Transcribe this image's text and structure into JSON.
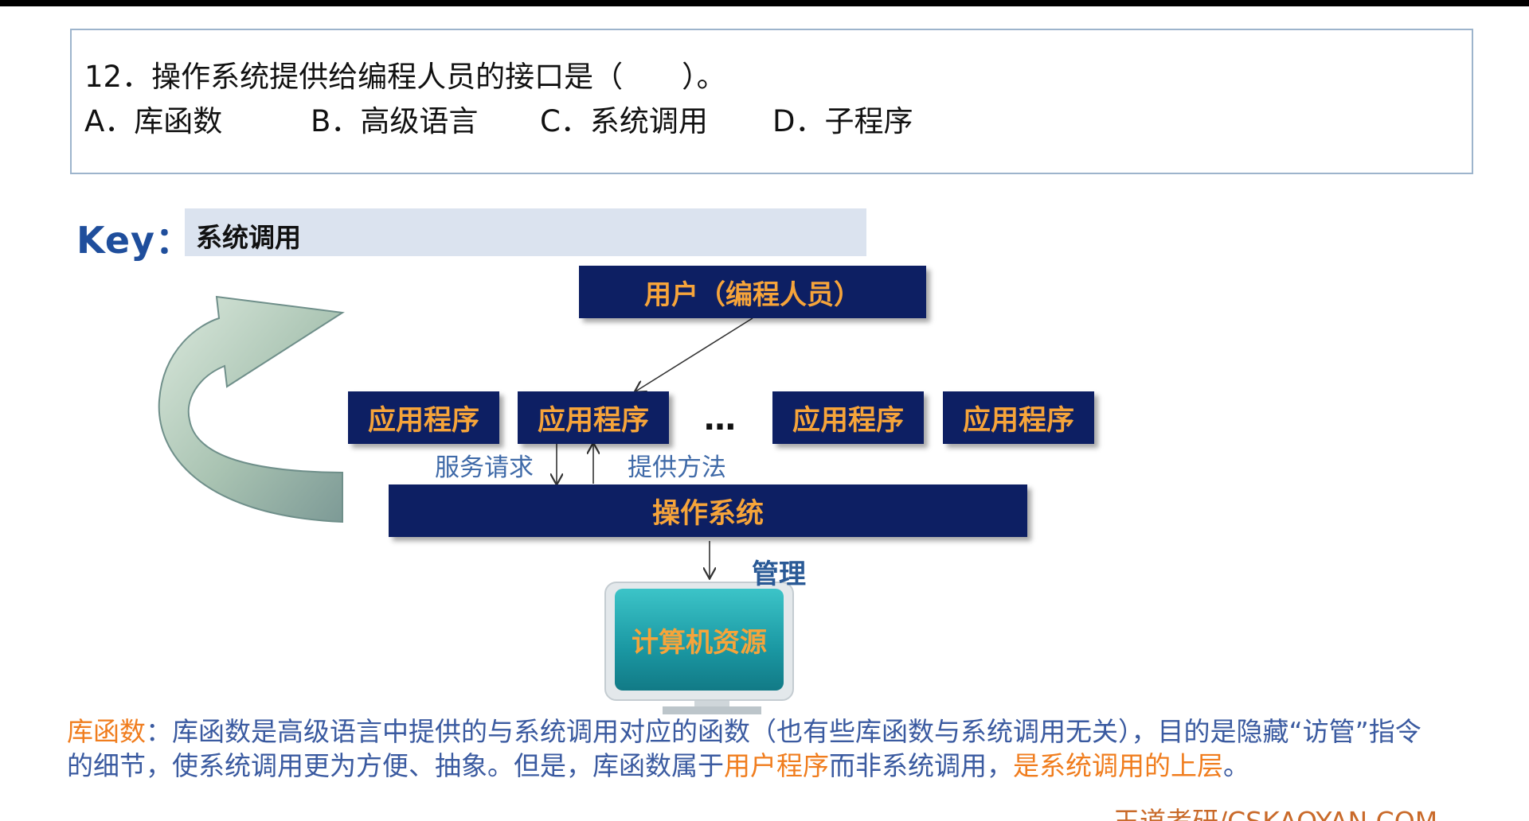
{
  "question": {
    "stem": "12．操作系统提供给编程人员的接口是（　　）。",
    "options": [
      {
        "text": "A．库函数"
      },
      {
        "text": "B．高级语言"
      },
      {
        "text": "C．系统调用"
      },
      {
        "text": "D．子程序"
      }
    ]
  },
  "key": {
    "label": "Key：",
    "answer": "系统调用"
  },
  "diagram": {
    "user_box": "用户（编程人员）",
    "apps": [
      "应用程序",
      "应用程序",
      "应用程序",
      "应用程序"
    ],
    "ellipsis": "…",
    "service_request": "服务请求",
    "provide_method": "提供方法",
    "os_box": "操作系统",
    "manage": "管理",
    "resource": "计算机资源"
  },
  "explanation": {
    "term": "库函数",
    "colon": "：",
    "part1": "库函数是高级语言中提供的与系统调用对应的函数（也有些库函数与系统调用无关），目的是隐藏“访管”指令的细节，使系统调用更为方便、抽象。但是，库函数属于",
    "highlight1": "用户程序",
    "part2": "而非系统调用，",
    "highlight2": "是系统调用的上层",
    "end": "。"
  },
  "watermark": "王道考研/CSKAOYAN.COM",
  "colors": {
    "box_fill": "#0d1f63",
    "box_text": "#f6a43a",
    "accent_orange": "#f07d1e",
    "text_blue": "#3a5aa0",
    "resource_teal": "#1aa0a8"
  }
}
